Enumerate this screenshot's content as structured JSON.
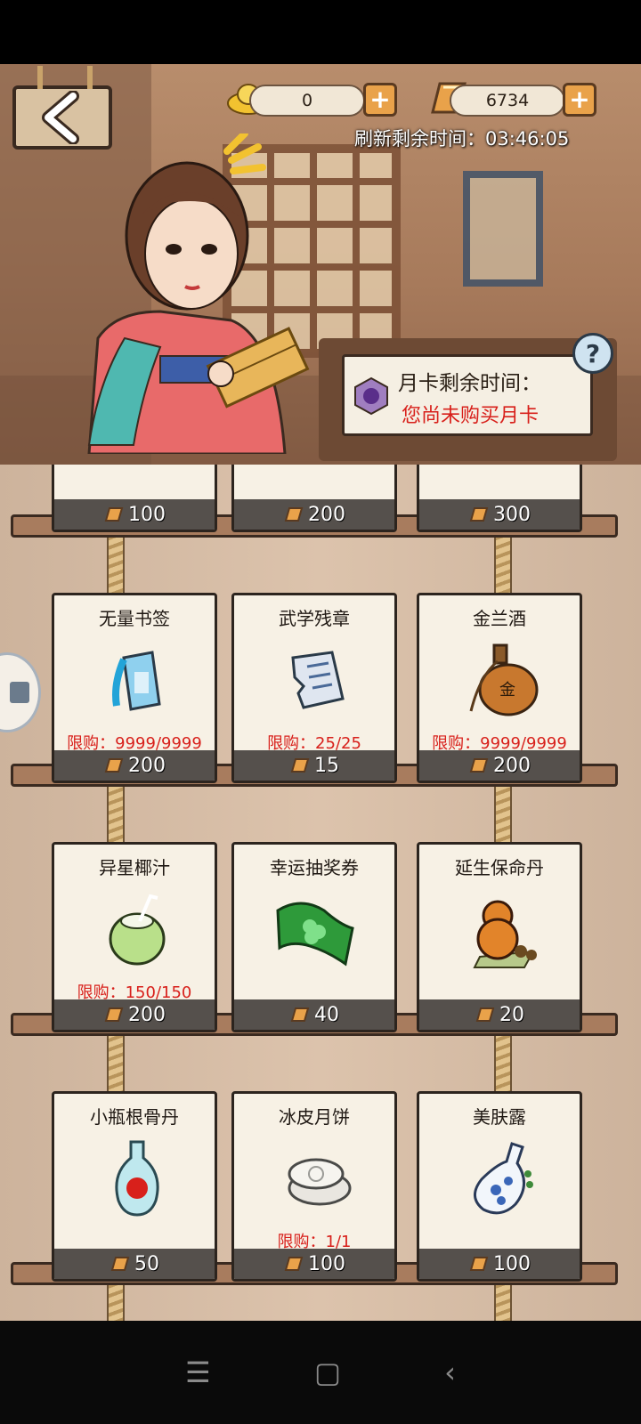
{
  "currency": {
    "yuanbao": "0",
    "gold_bars": "6734"
  },
  "refresh_timer": "刷新剩余时间：03:46:05",
  "month_card": {
    "title": "月卡剩余时间：",
    "status": "您尚未购买月卡"
  },
  "help_label": "?",
  "top_row_prices": [
    "100",
    "200",
    "300"
  ],
  "items": [
    {
      "name": "无量书签",
      "limit": "限购：9999/9999",
      "price": "200",
      "icon": "bookmark-icon"
    },
    {
      "name": "武学残章",
      "limit": "限购：25/25",
      "price": "15",
      "icon": "torn-page-icon"
    },
    {
      "name": "金兰酒",
      "limit": "限购：9999/9999",
      "price": "200",
      "icon": "wine-gourd-icon"
    },
    {
      "name": "异星椰汁",
      "limit": "限购：150/150",
      "price": "200",
      "icon": "coconut-icon"
    },
    {
      "name": "幸运抽奖券",
      "limit": "",
      "price": "40",
      "icon": "lottery-ticket-icon"
    },
    {
      "name": "延生保命丹",
      "limit": "",
      "price": "20",
      "icon": "pill-gourd-icon"
    },
    {
      "name": "小瓶根骨丹",
      "limit": "",
      "price": "50",
      "icon": "small-bottle-icon"
    },
    {
      "name": "冰皮月饼",
      "limit": "限购：1/1",
      "price": "100",
      "icon": "mooncake-icon"
    },
    {
      "name": "美肤露",
      "limit": "",
      "price": "100",
      "icon": "porcelain-vase-icon"
    }
  ],
  "colors": {
    "limit_text": "#d8201b",
    "price_bar": "#55504c",
    "card_bg": "#f7f1e5",
    "gold": "#e9a24a"
  }
}
